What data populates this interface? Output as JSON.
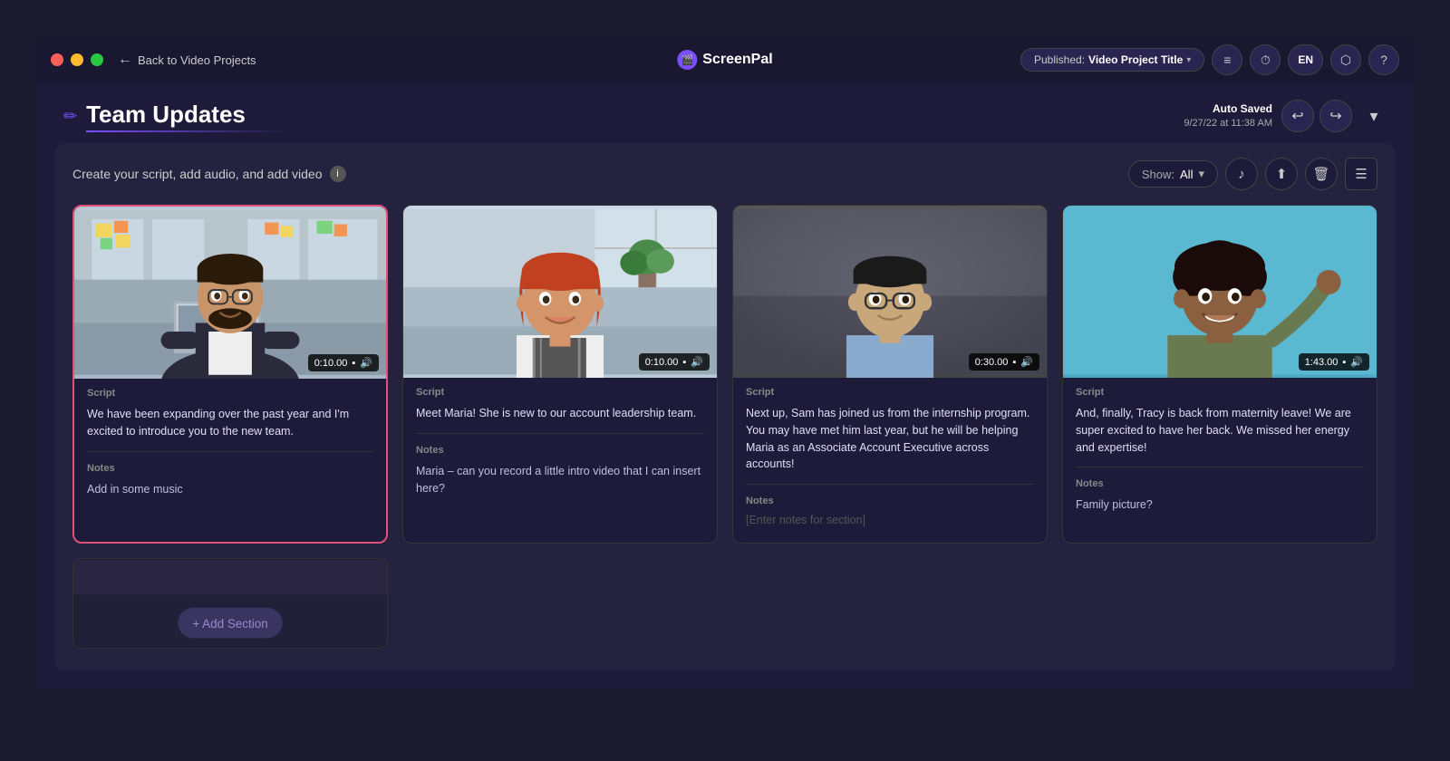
{
  "window": {
    "traffic_lights": [
      "red",
      "yellow",
      "green"
    ],
    "back_label": "Back to Video Projects",
    "logo_text": "ScreenPal",
    "published_label": "Published:",
    "published_title": "Video Project Title",
    "lang": "EN",
    "auto_saved_label": "Auto Saved",
    "auto_saved_time": "9/27/22 at 11:38 AM"
  },
  "page": {
    "title": "Team Updates",
    "instruction": "Create your script, add audio, and add video",
    "show_label": "Show:",
    "show_value": "All"
  },
  "cards": [
    {
      "id": "card-1",
      "selected": true,
      "duration": "0:10.00",
      "script_label": "Script",
      "script_text": "We have been expanding over the past year and I'm excited to introduce you to the new team.",
      "notes_label": "Notes",
      "notes_text": "Add in some music",
      "notes_placeholder": false,
      "thumb_type": "office-man"
    },
    {
      "id": "card-2",
      "selected": false,
      "duration": "0:10.00",
      "script_label": "Script",
      "script_text": "Meet Maria! She is new to our account leadership team.",
      "notes_label": "Notes",
      "notes_text": "Maria – can you record a little intro video that I can insert here?",
      "notes_placeholder": false,
      "thumb_type": "office-woman"
    },
    {
      "id": "card-3",
      "selected": false,
      "duration": "0:30.00",
      "script_label": "Script",
      "script_text": "Next up, Sam has joined us from the internship program. You may have met him last year, but he will be helping Maria as an Associate Account Executive across accounts!",
      "notes_label": "Notes",
      "notes_text": "",
      "notes_placeholder": true,
      "notes_placeholder_text": "[Enter notes for section]",
      "thumb_type": "dark-man"
    },
    {
      "id": "card-4",
      "selected": false,
      "duration": "1:43.00",
      "script_label": "Script",
      "script_text": "And, finally, Tracy is back from maternity leave! We are super excited to have her back. We missed her energy and expertise!",
      "notes_label": "Notes",
      "notes_text": "Family picture?",
      "notes_placeholder": false,
      "thumb_type": "blue-woman"
    }
  ],
  "toolbar": {
    "undo": "↩",
    "redo": "↪",
    "music_icon": "♪",
    "export_icon": "⬆",
    "delete_icon": "🗑",
    "list_icon": "☰",
    "info_icon": "i",
    "chevron_down": "▾"
  }
}
